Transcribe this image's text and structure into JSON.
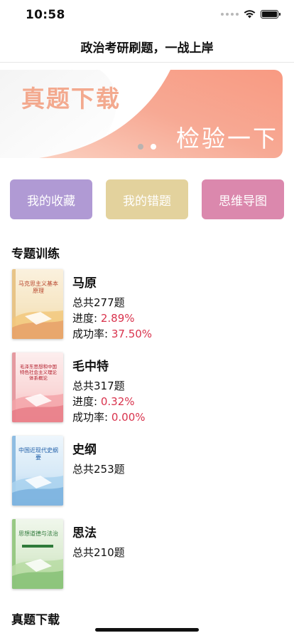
{
  "status_bar": {
    "time": "10:58"
  },
  "nav": {
    "title": "政治考研刷题，一战上岸"
  },
  "banner": {
    "title": "真题下载",
    "subtitle": "检验一下"
  },
  "quick_buttons": [
    {
      "label": "我的收藏",
      "color": "#b09ad4"
    },
    {
      "label": "我的错题",
      "color": "#e3d29d"
    },
    {
      "label": "思维导图",
      "color": "#db88ad"
    }
  ],
  "section_training": {
    "title": "专题训练"
  },
  "courses": [
    {
      "name": "马原",
      "total": "总共277题",
      "progress_label": "进度:",
      "progress_value": "2.89%",
      "success_label": "成功率:",
      "success_value": "37.50%",
      "book_title": "马克思主义基本原理"
    },
    {
      "name": "毛中特",
      "total": "总共317题",
      "progress_label": "进度:",
      "progress_value": "0.32%",
      "success_label": "成功率:",
      "success_value": "0.00%",
      "book_title": "毛泽东思想和中国特色社会主义理论体系概论"
    },
    {
      "name": "史纲",
      "total": "总共253题",
      "book_title": "中国近现代史纲要"
    },
    {
      "name": "思法",
      "total": "总共210题",
      "book_title": "思想道德与法治"
    }
  ],
  "section_download": {
    "title": "真题下载"
  },
  "colors": {
    "accent_red": "#d9334d",
    "banner_salmon": "#f3a98e"
  }
}
